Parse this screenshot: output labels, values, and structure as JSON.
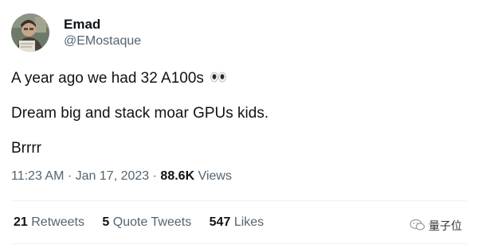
{
  "author": {
    "name": "Emad",
    "handle": "@EMostaque"
  },
  "tweet": {
    "line1": "A year ago we had 32 A100s",
    "line1_emoji_icon": "eyes-emoji",
    "line2": "Dream big and stack moar GPUs kids.",
    "line3": "Brrrr"
  },
  "meta": {
    "time": "11:23 AM",
    "sep1": "·",
    "date": "Jan 17, 2023",
    "sep2": "·",
    "views_count": "88.6K",
    "views_label": "Views"
  },
  "stats": {
    "retweets_count": "21",
    "retweets_label": "Retweets",
    "quote_count": "5",
    "quote_label": "Quote Tweets",
    "likes_count": "547",
    "likes_label": "Likes"
  },
  "watermark": {
    "text": "量子位"
  },
  "colors": {
    "text_primary": "#0f1419",
    "text_secondary": "#536471",
    "divider": "#eff3f4",
    "background": "#ffffff"
  }
}
